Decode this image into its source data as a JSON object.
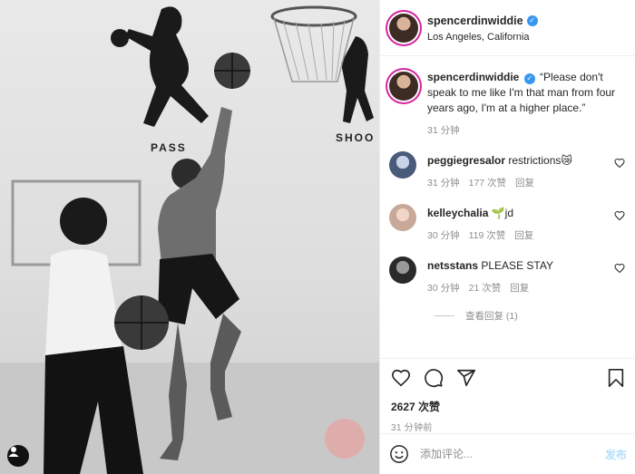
{
  "photo": {
    "wall_label_1": "PASS",
    "wall_label_2": "SHOO",
    "user_icon": "user-icon"
  },
  "header": {
    "username": "spencerdinwiddie",
    "verified_icon": "verified-badge-icon",
    "location": "Los Angeles, California"
  },
  "caption": {
    "username": "spencerdinwiddie",
    "text": "“Please don't speak to me like I'm that man from four years ago, I'm at a higher place.”",
    "time": "31 分钟"
  },
  "comments": [
    {
      "username": "peggiegresalor",
      "text": "restrictions😿",
      "time": "31 分钟",
      "likes": "177 次赞",
      "reply": "回复"
    },
    {
      "username": "kelleychalia",
      "text": "🌱jd",
      "time": "30 分钟",
      "likes": "119 次赞",
      "reply": "回复"
    },
    {
      "username": "netsstans",
      "text": "PLEASE STAY",
      "time": "30 分钟",
      "likes": "21 次赞",
      "reply": "回复"
    }
  ],
  "view_replies": "查看回复 (1)",
  "actions": {
    "like_icon": "heart-icon",
    "comment_icon": "comment-icon",
    "share_icon": "paper-plane-icon",
    "save_icon": "bookmark-icon",
    "likes": "2627 次赞",
    "posted": "31 分钟前"
  },
  "add_comment": {
    "emoji_icon": "smiley-icon",
    "placeholder": "添加评论...",
    "post_label": "发布"
  },
  "colors": {
    "accent": "#3897f0",
    "post_disabled": "#b2dffc",
    "muted": "#8e8e8e",
    "text": "#262626"
  }
}
